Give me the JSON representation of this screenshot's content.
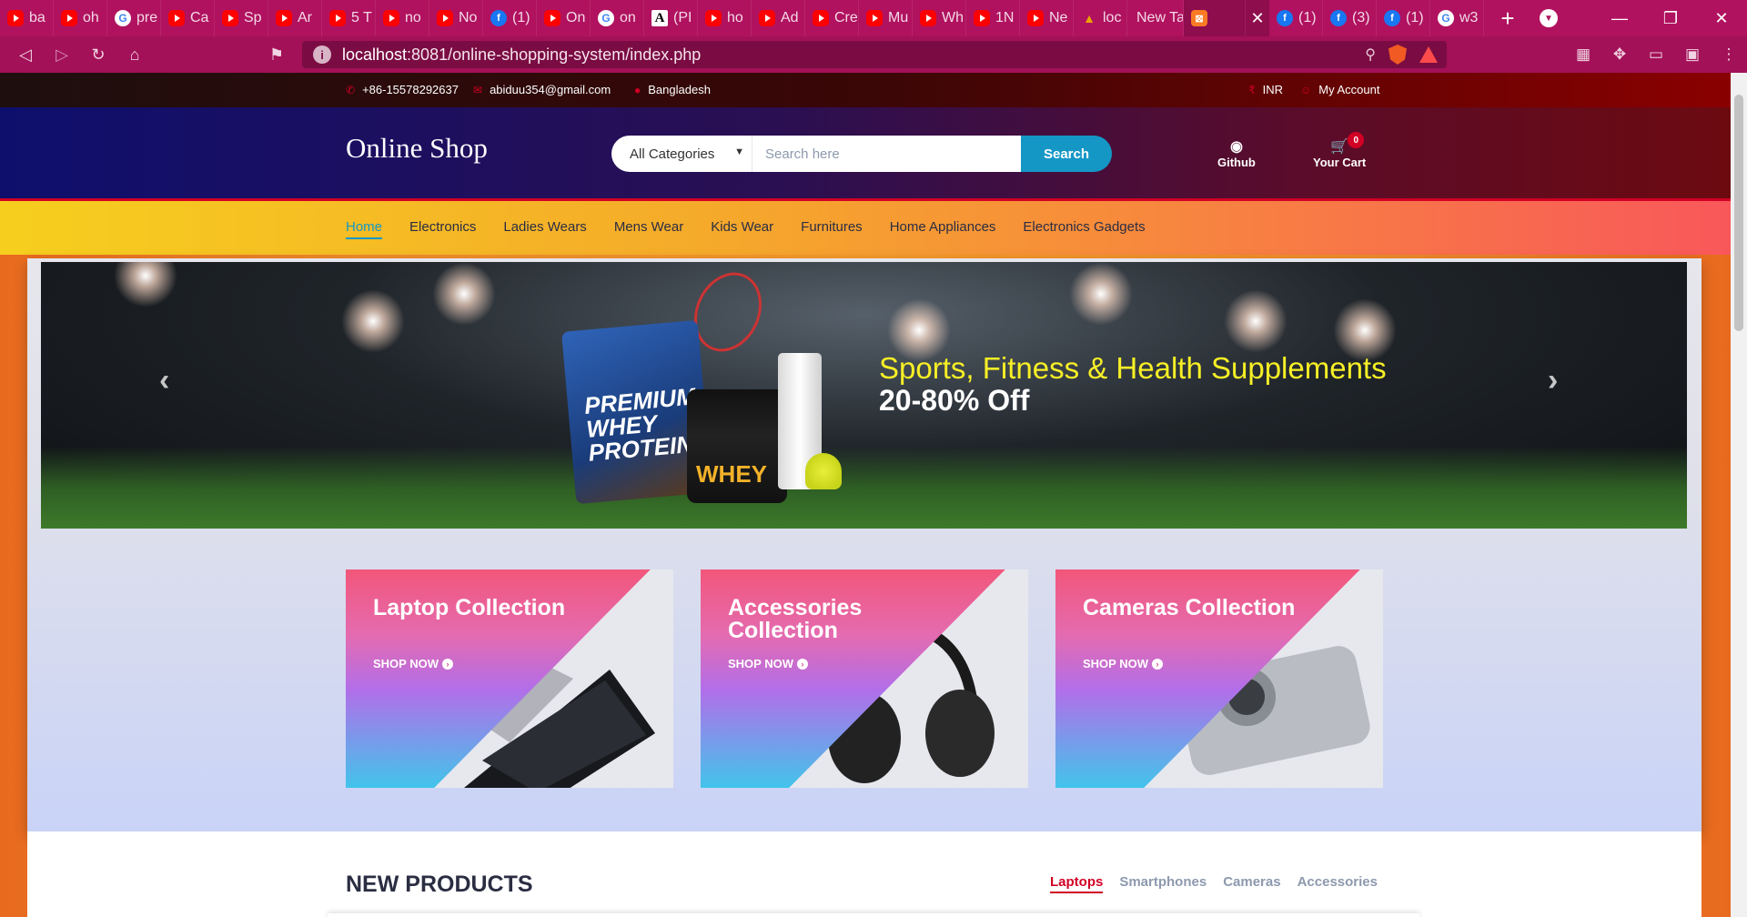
{
  "browser": {
    "tabs": [
      {
        "icon": "youtube-icon",
        "label": "ba"
      },
      {
        "icon": "youtube-icon",
        "label": "oh"
      },
      {
        "icon": "google-icon",
        "label": "pre"
      },
      {
        "icon": "youtube-icon",
        "label": "Ca"
      },
      {
        "icon": "youtube-icon",
        "label": "Sp"
      },
      {
        "icon": "youtube-icon",
        "label": "Ar"
      },
      {
        "icon": "youtube-icon",
        "label": "5 T"
      },
      {
        "icon": "youtube-icon",
        "label": "no"
      },
      {
        "icon": "youtube-icon",
        "label": "No"
      },
      {
        "icon": "facebook-icon",
        "label": "(1)"
      },
      {
        "icon": "youtube-icon",
        "label": "On"
      },
      {
        "icon": "google-icon",
        "label": "on"
      },
      {
        "icon": "a-icon",
        "label": "(PI"
      },
      {
        "icon": "youtube-icon",
        "label": "ho"
      },
      {
        "icon": "youtube-icon",
        "label": "Ad"
      },
      {
        "icon": "youtube-icon",
        "label": "Cre"
      },
      {
        "icon": "youtube-icon",
        "label": "Mu"
      },
      {
        "icon": "youtube-icon",
        "label": "Wh"
      },
      {
        "icon": "youtube-icon",
        "label": "1N"
      },
      {
        "icon": "youtube-icon",
        "label": "Ne"
      },
      {
        "icon": "triangle-icon",
        "label": "loc"
      }
    ],
    "newtab_label": "New Ta",
    "active_tab_icon": "xampp-icon",
    "tabs_after": [
      {
        "icon": "facebook-icon",
        "label": "(1)"
      },
      {
        "icon": "facebook-icon",
        "label": "(3)"
      },
      {
        "icon": "facebook-icon",
        "label": "(1)"
      },
      {
        "icon": "google-icon",
        "label": "w3"
      }
    ],
    "url_host": "localhost",
    "url_rest": ":8081/online-shopping-system/index.php"
  },
  "topbar": {
    "phone": "+86-15578292637",
    "email": "abiduu354@gmail.com",
    "location": "Bangladesh",
    "currency": "INR",
    "account": "My Account"
  },
  "header": {
    "logo": "Online Shop",
    "category_select": "All Categories",
    "search_placeholder": "Search here",
    "search_button": "Search",
    "github_label": "Github",
    "cart_label": "Your Cart",
    "cart_count": "0"
  },
  "nav": {
    "items": [
      "Home",
      "Electronics",
      "Ladies Wears",
      "Mens Wear",
      "Kids Wear",
      "Furnitures",
      "Home Appliances",
      "Electronics Gadgets"
    ],
    "active": "Home"
  },
  "slider": {
    "title": "Sports, Fitness & Health Supplements",
    "subtitle": "20-80% Off",
    "bag_text": "PREMIUM WHEY PROTEIN+",
    "tub_text": "WHEY"
  },
  "collections": [
    {
      "title": "Laptop Collection",
      "link": "SHOP NOW"
    },
    {
      "title": "Accessories Collection",
      "link": "SHOP NOW"
    },
    {
      "title": "Cameras Collection",
      "link": "SHOP NOW"
    }
  ],
  "new_products": {
    "title": "NEW PRODUCTS",
    "tabs": [
      "Laptops",
      "Smartphones",
      "Cameras",
      "Accessories"
    ],
    "active_tab": "Laptops"
  },
  "colors": {
    "brand_red": "#d10024",
    "accent_blue": "#1597c6",
    "browser_theme": "#b0125f"
  }
}
